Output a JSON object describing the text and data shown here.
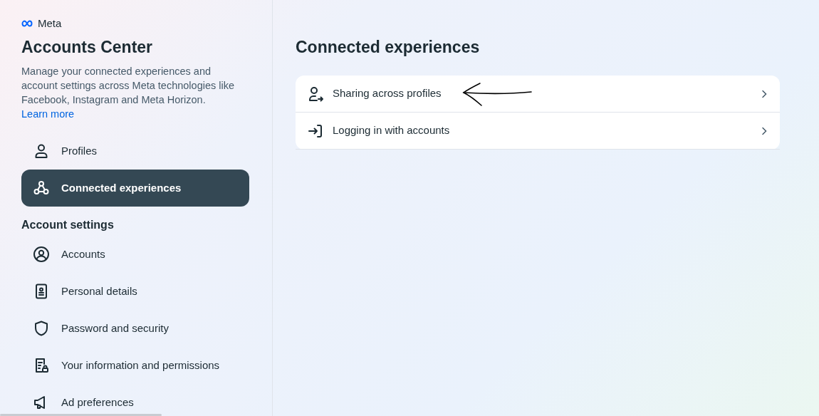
{
  "brand": "Meta",
  "sidebar": {
    "title": "Accounts Center",
    "description": "Manage your connected experiences and account settings across Meta technologies like Facebook, Instagram and Meta Horizon.",
    "link": "Learn more",
    "items": [
      {
        "label": "Profiles",
        "selected": false
      },
      {
        "label": "Connected experiences",
        "selected": true
      }
    ],
    "section_title": "Account settings",
    "settings_items": [
      {
        "label": "Accounts",
        "selected": false
      },
      {
        "label": "Personal details",
        "selected": false
      },
      {
        "label": "Password and security",
        "selected": false
      },
      {
        "label": "Your information and permissions",
        "selected": false
      },
      {
        "label": "Ad preferences",
        "selected": false
      }
    ]
  },
  "main": {
    "title": "Connected experiences",
    "options": [
      {
        "label": "Sharing across profiles"
      },
      {
        "label": "Logging in with accounts"
      }
    ]
  }
}
